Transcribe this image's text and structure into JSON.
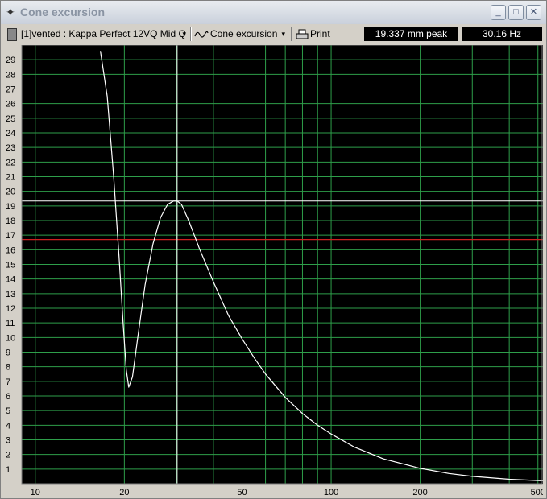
{
  "window": {
    "title": "Cone excursion",
    "minimize_glyph": "_",
    "maximize_glyph": "□",
    "close_glyph": "✕"
  },
  "toolbar": {
    "speaker_select": "[1]vented : Kappa Perfect 12VQ Mid Q",
    "mode_select": "Cone excursion",
    "print_label": "Print",
    "excursion_readout": "19.337 mm peak",
    "frequency_readout": "30.16 Hz",
    "dropdown_glyph": "▾"
  },
  "colors": {
    "plot_bg": "#000000",
    "grid": "#2e9e4a",
    "curve": "#ffffff",
    "cursor": "#ffffff",
    "limit_line": "#cc2020"
  },
  "chart_data": {
    "type": "line",
    "x_scale": "log",
    "xlim": [
      9,
      520
    ],
    "ylim": [
      0,
      30
    ],
    "grid": true,
    "x_tick_labels": [
      {
        "value": 10,
        "label": "10"
      },
      {
        "value": 20,
        "label": "20"
      },
      {
        "value": 50,
        "label": "50"
      },
      {
        "value": 100,
        "label": "100"
      },
      {
        "value": 200,
        "label": "200"
      },
      {
        "value": 500,
        "label": "500"
      }
    ],
    "x_grid": [
      10,
      20,
      30,
      40,
      50,
      60,
      70,
      80,
      90,
      100,
      200,
      300,
      400,
      500
    ],
    "y_ticks": [
      1,
      2,
      3,
      4,
      5,
      6,
      7,
      8,
      9,
      10,
      11,
      12,
      13,
      14,
      15,
      16,
      17,
      18,
      19,
      20,
      21,
      22,
      23,
      24,
      25,
      26,
      27,
      28,
      29
    ],
    "cursor": {
      "x": 30.16,
      "y": 19.337
    },
    "limit_line_y": 16.7,
    "series": [
      {
        "x": [
          16.6,
          17.5,
          18.4,
          19.2,
          19.8,
          20.3,
          20.7,
          21.3,
          22.2,
          23.5,
          25,
          26.5,
          28,
          29.3,
          30.16,
          31.2,
          33,
          36,
          40,
          45,
          50,
          55,
          60,
          70,
          80,
          90,
          100,
          120,
          150,
          200,
          250,
          300,
          400,
          520
        ],
        "y": [
          29.6,
          26.5,
          21,
          15.5,
          11,
          7.8,
          6.6,
          7.3,
          10,
          13.6,
          16.4,
          18.2,
          19.1,
          19.33,
          19.337,
          19.1,
          18,
          16,
          13.8,
          11.5,
          9.9,
          8.6,
          7.5,
          5.9,
          4.8,
          4.0,
          3.4,
          2.5,
          1.7,
          1.05,
          0.7,
          0.5,
          0.3,
          0.2
        ]
      }
    ]
  }
}
